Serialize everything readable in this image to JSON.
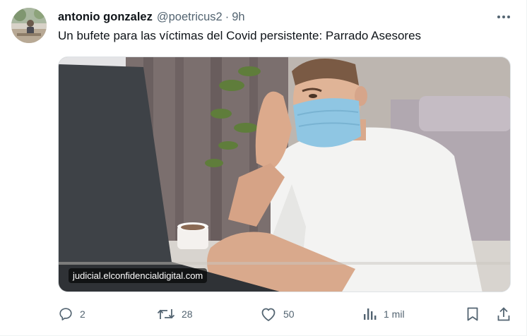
{
  "tweet": {
    "author_name": "antonio gonzalez",
    "handle": "@poetricus2",
    "separator": "·",
    "time": "9h",
    "text": "Un bufete para las víctimas del Covid persistente: Parrado Asesores"
  },
  "media": {
    "domain": "judicial.elconfidencialdigital.com"
  },
  "actions": {
    "replies": "2",
    "retweets": "28",
    "likes": "50",
    "views": "1 mil"
  },
  "icons": {
    "more": "more-horizontal-icon",
    "reply": "reply-icon",
    "retweet": "retweet-icon",
    "like": "heart-icon",
    "views": "analytics-icon",
    "bookmark": "bookmark-icon",
    "share": "share-icon"
  },
  "colors": {
    "text_primary": "#0f1419",
    "text_secondary": "#536471"
  }
}
